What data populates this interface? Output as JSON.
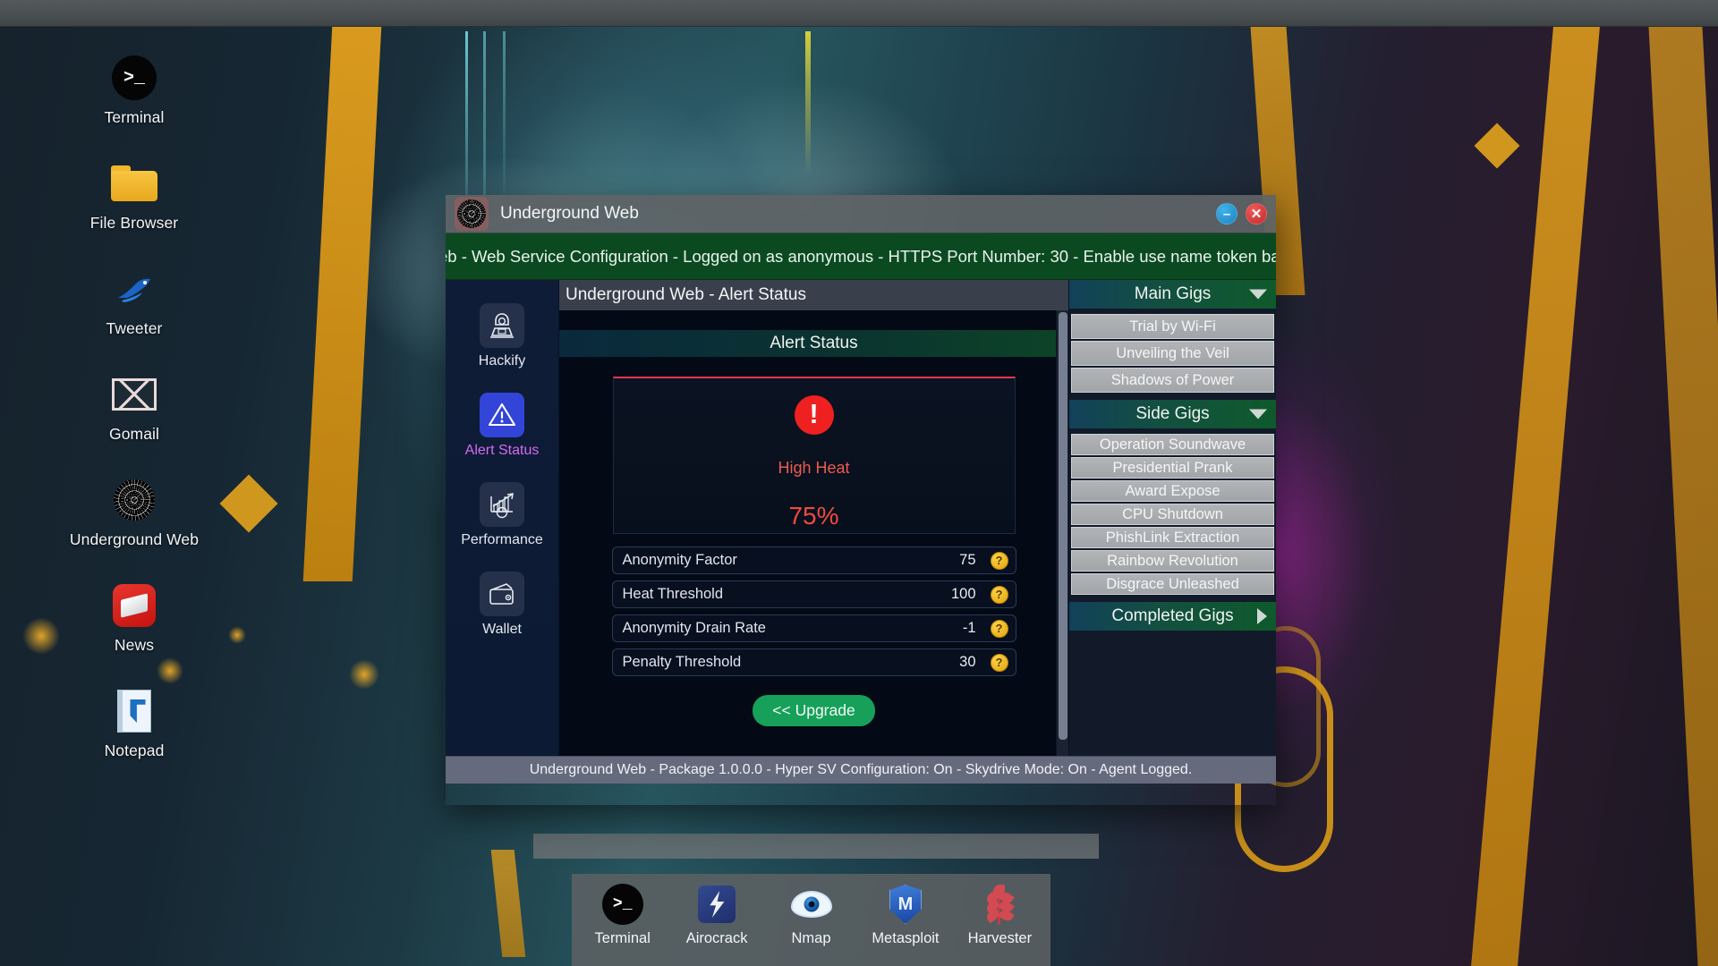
{
  "desktop": {
    "icons": [
      {
        "label": "Terminal",
        "icon": "terminal-icon"
      },
      {
        "label": "File Browser",
        "icon": "folder-icon"
      },
      {
        "label": "Tweeter",
        "icon": "bird-icon"
      },
      {
        "label": "Gomail",
        "icon": "envelope-icon"
      },
      {
        "label": "Underground Web",
        "icon": "spiderweb-icon"
      },
      {
        "label": "News",
        "icon": "news-icon"
      },
      {
        "label": "Notepad",
        "icon": "notepad-icon"
      }
    ]
  },
  "window": {
    "title": "Underground Web",
    "icon": "spiderweb-icon",
    "minimize_label": "–",
    "close_label": "✕",
    "marquee": "eb - Web Service Configuration - Logged on as anonymous - HTTPS Port Number: 30 - Enable use name token based se",
    "panel_title": "Underground Web - Alert Status",
    "status_bar": "Underground Web - Package 1.0.0.0 - Hyper SV Configuration: On - Skydrive Mode: On - Agent Logged."
  },
  "left_nav": {
    "items": [
      {
        "label": "Hackify",
        "icon": "hacker-icon",
        "active": false
      },
      {
        "label": "Alert Status",
        "icon": "warning-triangle-icon",
        "active": true
      },
      {
        "label": "Performance",
        "icon": "chart-gear-icon",
        "active": false
      },
      {
        "label": "Wallet",
        "icon": "wallet-icon",
        "active": false
      }
    ]
  },
  "alert": {
    "section_title": "Alert Status",
    "badge_icon": "exclamation-circle-icon",
    "badge_symbol": "!",
    "level_label": "High Heat",
    "percent": "75%",
    "accent_color": "#ef4a3c",
    "stats": [
      {
        "name": "Anonymity Factor",
        "value": "75",
        "help": "?"
      },
      {
        "name": "Heat Threshold",
        "value": "100",
        "help": "?"
      },
      {
        "name": "Anonymity Drain Rate",
        "value": "-1",
        "help": "?"
      },
      {
        "name": "Penalty Threshold",
        "value": "30",
        "help": "?"
      }
    ],
    "upgrade_label": "<< Upgrade"
  },
  "gigs": {
    "sections": [
      {
        "title": "Main Gigs",
        "expanded": true,
        "arrow": "chevron-down-icon",
        "items": [
          "Trial by Wi-Fi",
          "Unveiling the Veil",
          "Shadows of Power"
        ]
      },
      {
        "title": "Side Gigs",
        "expanded": true,
        "arrow": "chevron-down-icon",
        "items": [
          "Operation Soundwave",
          "Presidential Prank",
          "Award Expose",
          "CPU Shutdown",
          "PhishLink Extraction",
          "Rainbow Revolution",
          "Disgrace Unleashed"
        ]
      },
      {
        "title": "Completed Gigs",
        "expanded": false,
        "arrow": "chevron-right-icon",
        "items": []
      }
    ]
  },
  "dock": {
    "items": [
      {
        "label": "Terminal",
        "icon": "terminal-icon"
      },
      {
        "label": "Airocrack",
        "icon": "airocrack-icon"
      },
      {
        "label": "Nmap",
        "icon": "eye-icon"
      },
      {
        "label": "Metasploit",
        "icon": "shield-m-icon"
      },
      {
        "label": "Harvester",
        "icon": "wheat-icon"
      }
    ]
  }
}
